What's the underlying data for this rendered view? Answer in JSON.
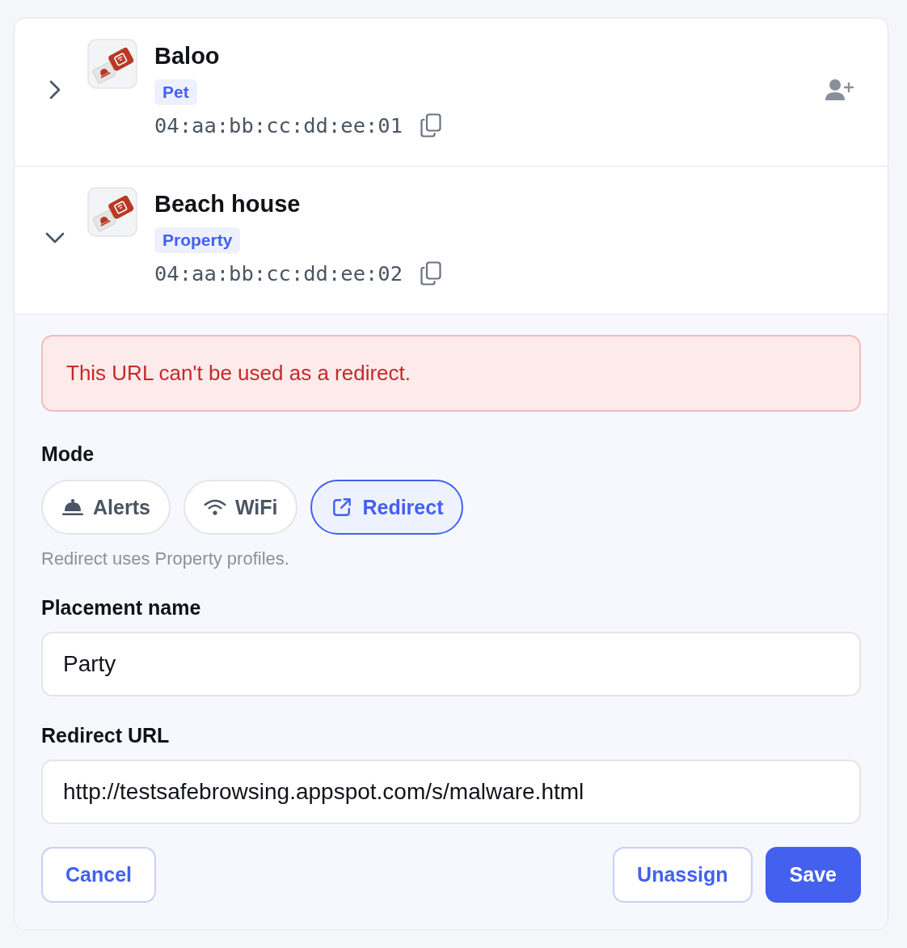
{
  "items": [
    {
      "name": "Baloo",
      "tag": "Pet",
      "uid": "04:aa:bb:cc:dd:ee:01",
      "expanded": false,
      "assigned": false
    },
    {
      "name": "Beach house",
      "tag": "Property",
      "uid": "04:aa:bb:cc:dd:ee:02",
      "expanded": true,
      "assigned": true
    }
  ],
  "editor": {
    "error": "This URL can't be used as a redirect.",
    "mode_label": "Mode",
    "modes": [
      {
        "kind": "alerts",
        "label": "Alerts",
        "selected": false
      },
      {
        "kind": "wifi",
        "label": "WiFi",
        "selected": false
      },
      {
        "kind": "redirect",
        "label": "Redirect",
        "selected": true
      }
    ],
    "mode_hint": "Redirect uses Property profiles.",
    "fields": [
      {
        "label": "Placement name",
        "value": "Party"
      },
      {
        "label": "Redirect URL",
        "value": "http://testsafebrowsing.appspot.com/s/malware.html"
      }
    ],
    "buttons_left": [
      {
        "label": "Cancel",
        "primary": false
      }
    ],
    "buttons_right": [
      {
        "label": "Unassign",
        "primary": false
      },
      {
        "label": "Save",
        "primary": true
      }
    ]
  }
}
